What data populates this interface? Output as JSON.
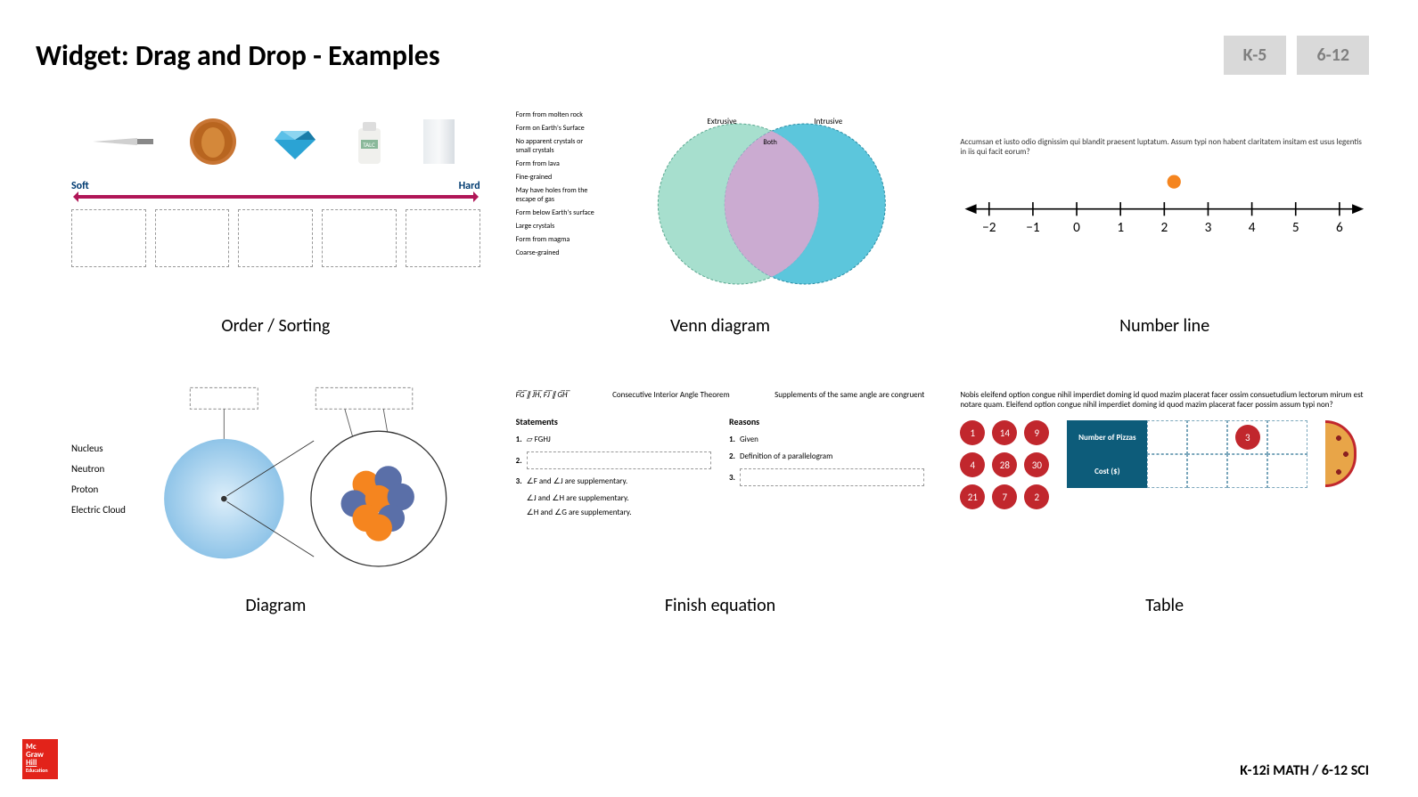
{
  "title": "Widget: Drag and Drop - Examples",
  "tabs": [
    "K-5",
    "6-12"
  ],
  "footer": {
    "logo_lines": [
      "Mc",
      "Graw",
      "Hill",
      "Education"
    ],
    "course": "K-12i MATH / 6-12 SCI"
  },
  "examples": {
    "sorting": {
      "label": "Order / Sorting",
      "scale_left": "Soft",
      "scale_right": "Hard",
      "item_talc": "TALC"
    },
    "venn": {
      "label": "Venn diagram",
      "items": [
        "Form from molten rock",
        "Form on Earth's Surface",
        "No apparent crystals or small crystals",
        "Form from lava",
        "Fine-grained",
        "May have holes from the escape of gas",
        "Form below Earth's surface",
        "Large crystals",
        "Form from magma",
        "Coarse-grained"
      ],
      "left_label": "Extrusive",
      "right_label": "Intrusive",
      "both_label": "Both"
    },
    "numberline": {
      "label": "Number line",
      "text": "Accumsan et iusto odio dignissim qui blandit praesent luptatum. Assum typi non habent claritatem insitam est usus legentis in iis qui facit eorum?",
      "ticks": [
        "−2",
        "−1",
        "0",
        "1",
        "2",
        "3",
        "4",
        "5",
        "6"
      ],
      "marker_value": 2
    },
    "diagram": {
      "label": "Diagram",
      "terms": [
        "Nucleus",
        "Neutron",
        "Proton",
        "Electric Cloud"
      ]
    },
    "finish_eq": {
      "label": "Finish equation",
      "top": [
        "F̅G̅ ∥ J̅H̅, F̅J̅ ∥ G̅H̅",
        "Consecutive Interior Angle Theorem",
        "Supplements of the same angle are congruent"
      ],
      "statements_h": "Statements",
      "reasons_h": "Reasons",
      "s1": "▱ FGHJ",
      "r1": "Given",
      "r2": "Definition of a parallelogram",
      "s3": "∠F and ∠J are supplementary.",
      "s3a": "∠J and ∠H are supplementary.",
      "s3b": "∠H and ∠G are supplementary."
    },
    "table": {
      "label": "Table",
      "text": "Nobis eleifend option congue nihil imperdiet doming id quod mazim placerat facer ossim consuetudium lectorum mirum est notare quam. Eleifend option congue nihil imperdiet doming id quod mazim placerat facer possim assum typi non?",
      "chips": [
        "1",
        "14",
        "9",
        "4",
        "28",
        "30",
        "21",
        "7",
        "2"
      ],
      "row1_h": "Number of Pizzas",
      "row2_h": "Cost ($)",
      "placed_chip": "3"
    }
  }
}
